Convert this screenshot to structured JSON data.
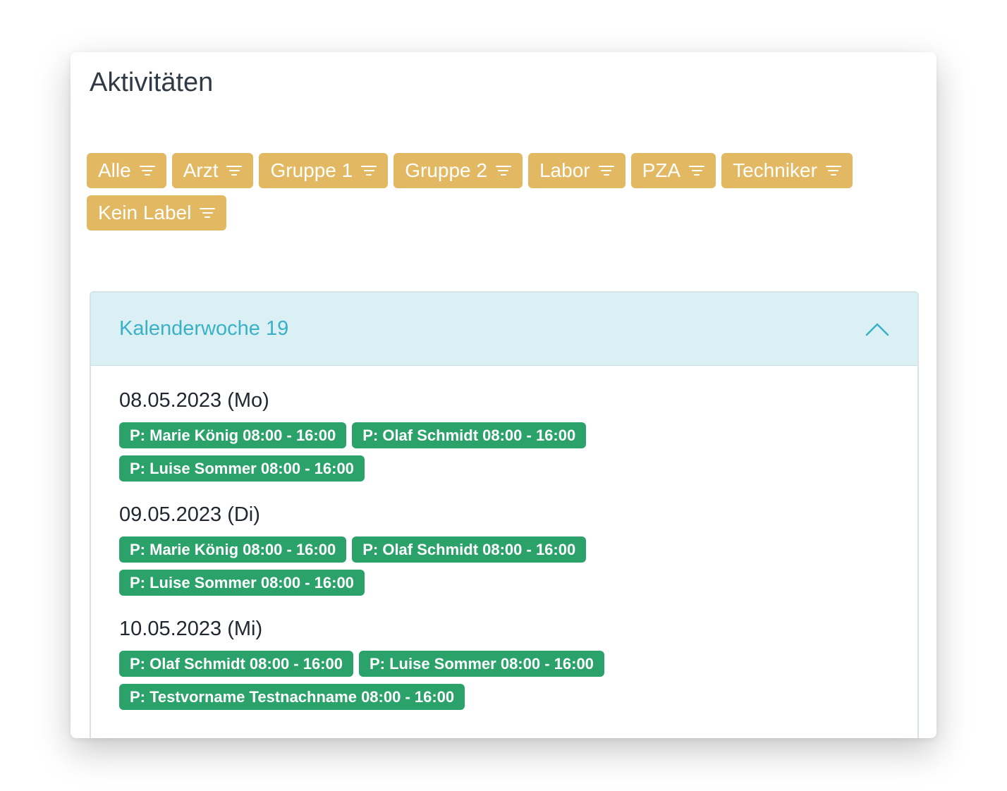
{
  "title": "Aktivitäten",
  "colors": {
    "filter_chip": "#e3b862",
    "badge": "#2aa26a",
    "week_header_bg": "#daf0f5",
    "week_header_text": "#3ab1c6"
  },
  "filters": [
    {
      "label": "Alle",
      "icon": "filter-icon"
    },
    {
      "label": "Arzt",
      "icon": "filter-icon"
    },
    {
      "label": "Gruppe 1",
      "icon": "filter-icon"
    },
    {
      "label": "Gruppe 2",
      "icon": "filter-icon"
    },
    {
      "label": "Labor",
      "icon": "filter-icon"
    },
    {
      "label": "PZA",
      "icon": "filter-icon"
    },
    {
      "label": "Techniker",
      "icon": "filter-icon"
    },
    {
      "label": "Kein Label",
      "icon": "filter-icon"
    }
  ],
  "week": {
    "title": "Kalenderwoche 19",
    "toggle_icon": "chevron-up-icon",
    "days": [
      {
        "date": "08.05.2023 (Mo)",
        "entries": [
          "P: Marie König 08:00 - 16:00",
          "P: Olaf Schmidt 08:00 - 16:00",
          "P: Luise Sommer 08:00 - 16:00"
        ]
      },
      {
        "date": "09.05.2023 (Di)",
        "entries": [
          "P: Marie König 08:00 - 16:00",
          "P: Olaf Schmidt 08:00 - 16:00",
          "P: Luise Sommer 08:00 - 16:00"
        ]
      },
      {
        "date": "10.05.2023 (Mi)",
        "entries": [
          "P: Olaf Schmidt 08:00 - 16:00",
          "P: Luise Sommer 08:00 - 16:00",
          "P: Testvorname Testnachname 08:00 - 16:00"
        ]
      }
    ]
  }
}
